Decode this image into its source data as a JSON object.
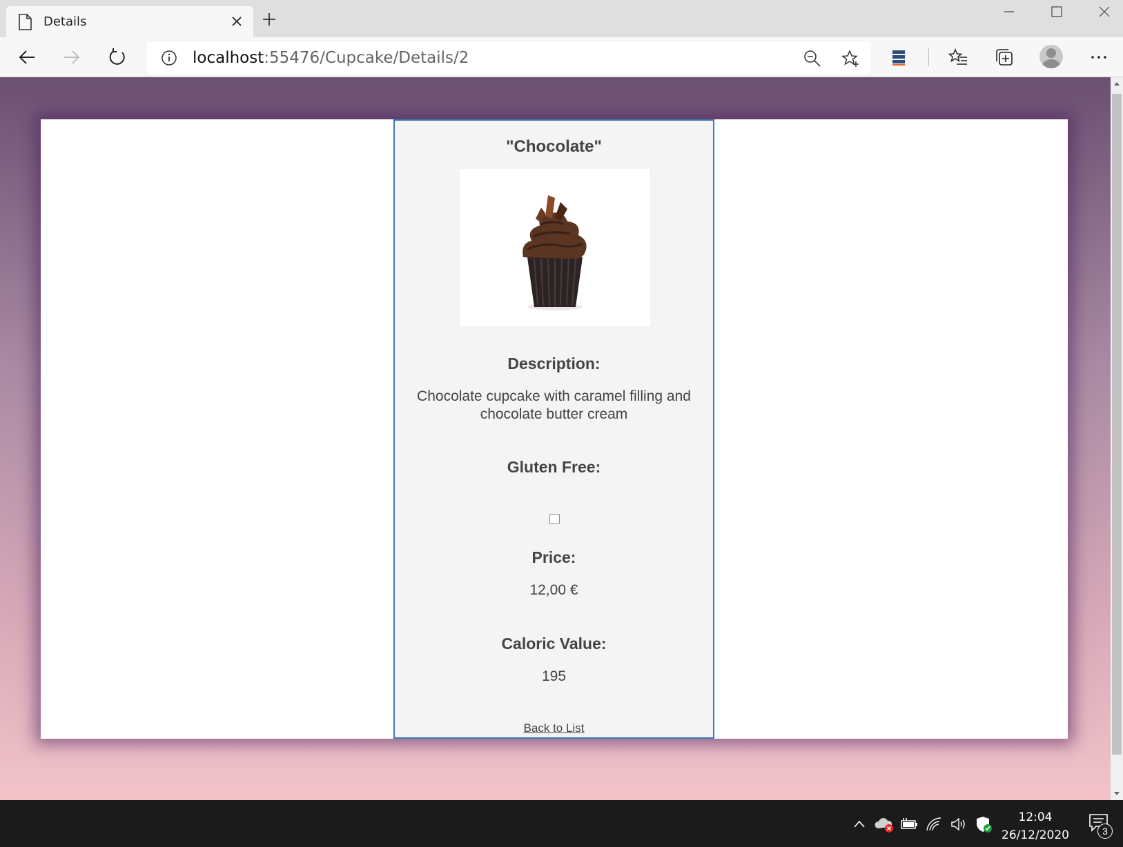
{
  "browser": {
    "tab": {
      "title": "Details"
    },
    "address": {
      "host": "localhost",
      "path": ":55476/Cupcake/Details/2"
    }
  },
  "cupcake": {
    "name": "\"Chocolate\"",
    "description_label": "Description:",
    "description": "Chocolate cupcake with caramel filling and chocolate butter cream",
    "gluten_free_label": "Gluten Free:",
    "gluten_free": false,
    "price_label": "Price:",
    "price": "12,00 €",
    "caloric_label": "Caloric Value:",
    "caloric_value": "195",
    "back_link": "Back to List"
  },
  "taskbar": {
    "time": "12:04",
    "date": "26/12/2020",
    "notification_count": "3"
  },
  "colors": {
    "card_border": "#3e79b1",
    "page_gradient_top": "#6b5072",
    "page_gradient_bottom": "#f2c3c9"
  }
}
